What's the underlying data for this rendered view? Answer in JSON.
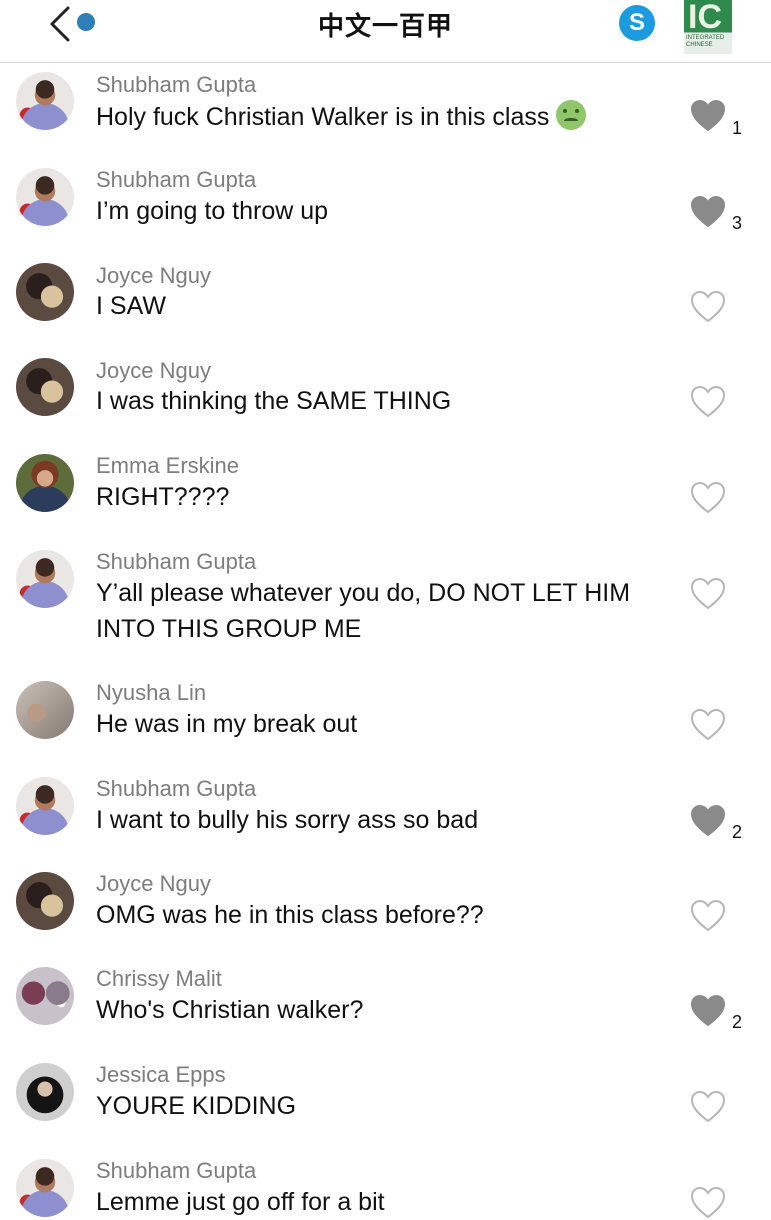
{
  "header": {
    "title": "中文一百甲",
    "back_icon": "chevron-left-icon",
    "call_icon": "skype-icon",
    "call_letter": "S",
    "group_image_letters": "IC",
    "group_image_caption": "INTEGRATED CHINESE",
    "accent_color": "#2f7fb8"
  },
  "messages": [
    {
      "sender": "Shubham Gupta",
      "text": "Holy fuck Christian Walker is in this class",
      "emoji": "nauseated-face",
      "liked": true,
      "likes": "1"
    },
    {
      "sender": "Shubham Gupta",
      "text": "I’m going to throw up",
      "liked": true,
      "likes": "3"
    },
    {
      "sender": "Joyce Nguy",
      "text": "I SAW",
      "liked": false,
      "likes": ""
    },
    {
      "sender": "Joyce Nguy",
      "text": "I was thinking the SAME THING",
      "liked": false,
      "likes": ""
    },
    {
      "sender": "Emma Erskine",
      "text": "RIGHT????",
      "liked": false,
      "likes": ""
    },
    {
      "sender": "Shubham Gupta",
      "text": "Y’all please whatever you do, DO NOT LET HIM INTO THIS GROUP ME",
      "liked": false,
      "likes": ""
    },
    {
      "sender": "Nyusha Lin",
      "text": "He was in my break out",
      "liked": false,
      "likes": ""
    },
    {
      "sender": "Shubham Gupta",
      "text": "I want to bully his sorry ass so bad",
      "liked": true,
      "likes": "2"
    },
    {
      "sender": "Joyce Nguy",
      "text": "OMG was he in this class before??",
      "liked": false,
      "likes": ""
    },
    {
      "sender": "Chrissy Malit",
      "text": "Who's Christian walker?",
      "liked": true,
      "likes": "2"
    },
    {
      "sender": "Jessica Epps",
      "text": "YOURE KIDDING",
      "liked": false,
      "likes": ""
    },
    {
      "sender": "Shubham Gupta",
      "text": "Lemme just go off for a bit",
      "liked": false,
      "likes": ""
    }
  ],
  "colors": {
    "liked_heart": "#8a8a8a",
    "unliked_heart": "#b5b5b5",
    "sender_name": "#7d7d7d"
  }
}
